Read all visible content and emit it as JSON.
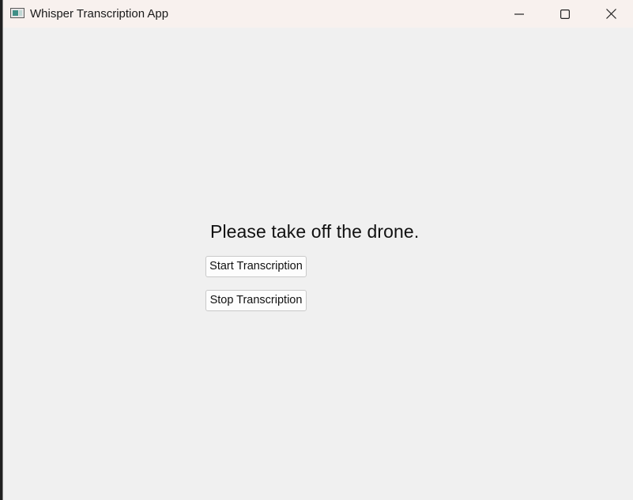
{
  "window": {
    "title": "Whisper Transcription App",
    "icon": "app-window-icon",
    "controls": {
      "minimize_icon": "minimize-icon",
      "maximize_icon": "maximize-icon",
      "close_icon": "close-icon"
    }
  },
  "main": {
    "prompt": "Please take off the drone.",
    "start_button_label": "Start Transcription",
    "stop_button_label": "Stop Transcription"
  },
  "colors": {
    "titlebar": "#f8f1ee",
    "window_background": "#f0f0f0",
    "button_background": "#fdfdfd",
    "button_border": "#c9c9c9"
  }
}
